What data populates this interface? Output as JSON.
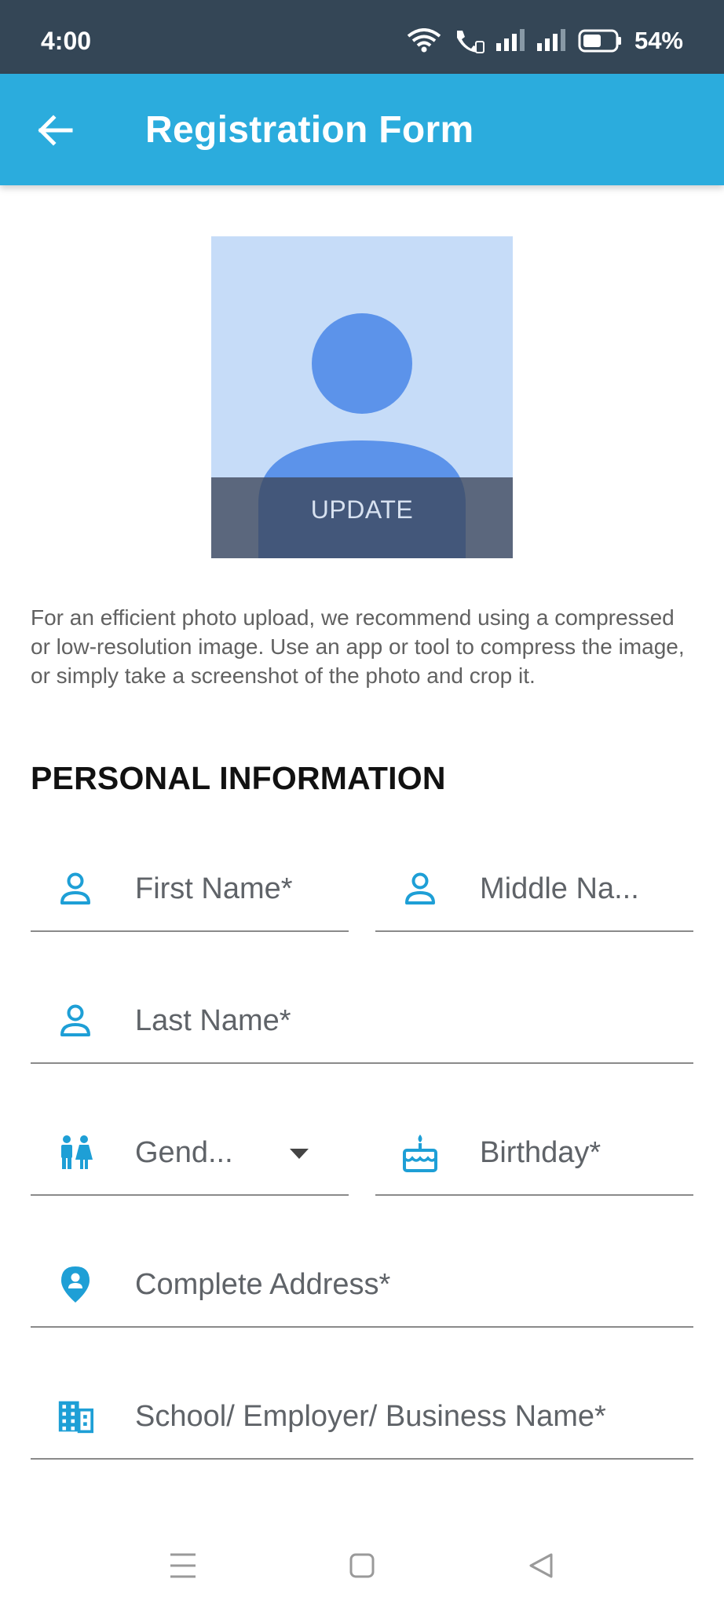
{
  "status_bar": {
    "time": "4:00",
    "battery": "54%"
  },
  "app_bar": {
    "title": "Registration Form",
    "back_icon": "arrow-left-icon"
  },
  "photo": {
    "update_label": "UPDATE",
    "placeholder_icon": "person-placeholder-icon"
  },
  "hint_text": "For an efficient photo upload, we recommend using a compressed or low-resolution image. Use an app or tool to compress the image, or simply take a screenshot of the photo and crop it.",
  "section": {
    "title": "PERSONAL INFORMATION"
  },
  "fields": {
    "first_name": "First Name*",
    "middle_name": "Middle Na...",
    "last_name": "Last Name*",
    "gender": "Gend...",
    "birthday": "Birthday*",
    "address": "Complete Address*",
    "school": "School/ Employer/ Business Name*"
  },
  "colors": {
    "accent": "#2bacdd",
    "status_bar": "#344656",
    "icon": "#1e9fd6"
  }
}
